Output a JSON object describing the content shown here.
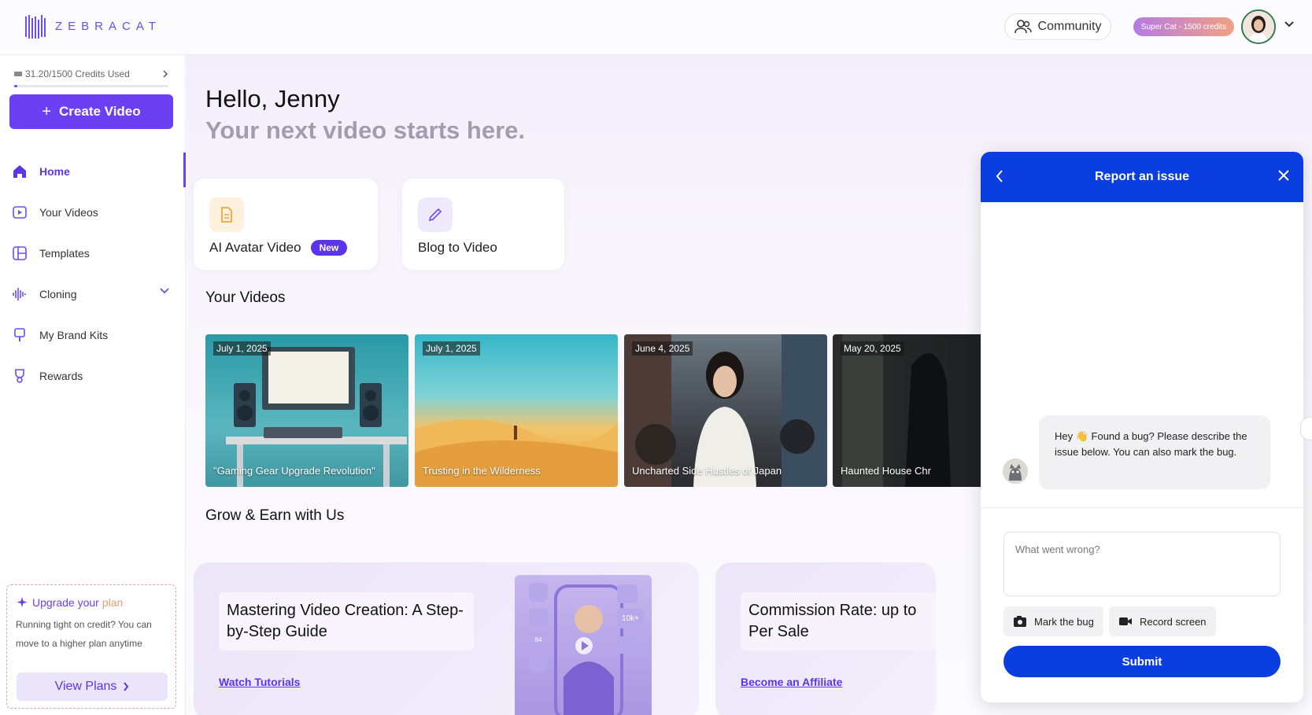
{
  "brand": {
    "name": "ZEBRACAT",
    "accent": "#6b3ff2",
    "panel_blue": "#0b3ee0"
  },
  "header": {
    "community_label": "Community",
    "plan_badge": "Super Cat - 1500 credits"
  },
  "sidebar": {
    "credits_label": "31.20/1500 Credits Used",
    "credits_used_fraction": 0.0208,
    "create_label": "Create Video",
    "items": [
      {
        "label": "Home",
        "icon": "home-icon",
        "active": true
      },
      {
        "label": "Your Videos",
        "icon": "play-square-icon"
      },
      {
        "label": "Templates",
        "icon": "layout-icon"
      },
      {
        "label": "Cloning",
        "icon": "waveform-icon"
      },
      {
        "label": "My Brand Kits",
        "icon": "brand-kit-icon"
      },
      {
        "label": "Rewards",
        "icon": "trophy-icon"
      }
    ],
    "upgrade": {
      "title_part1": "Upgrade your",
      "title_part2": "plan",
      "text": "Running tight on credit? You can move to a higher plan anytime",
      "button": "View Plans"
    }
  },
  "main": {
    "greeting": "Hello, Jenny",
    "subtitle": "Your next video starts here.",
    "quick_actions": [
      {
        "label": "AI Avatar Video",
        "badge": "New",
        "icon": "document-icon"
      },
      {
        "label": "Blog to Video",
        "icon": "pencil-icon"
      }
    ],
    "your_videos_title": "Your Videos",
    "videos": [
      {
        "date": "July 1, 2025",
        "title": "\"Gaming Gear Upgrade Revolution\""
      },
      {
        "date": "July 1, 2025",
        "title": "Trusting in the Wilderness"
      },
      {
        "date": "June 4, 2025",
        "title": "Uncharted Side Hustles of Japan"
      },
      {
        "date": "May 20, 2025",
        "title": "Haunted House Chr"
      }
    ],
    "grow_title": "Grow & Earn with Us",
    "grow_cards": [
      {
        "title": "Mastering Video Creation: A Step-by-Step Guide",
        "link": "Watch Tutorials"
      },
      {
        "title": "Commission Rate: up to Per Sale",
        "link": "Become an Affiliate"
      }
    ],
    "phone_stats": [
      "10k+",
      "84"
    ]
  },
  "report_panel": {
    "title": "Report an issue",
    "message": "Hey 👋 Found a bug? Please describe the issue below. You can also mark the bug.",
    "input_placeholder": "What went wrong?",
    "mark_bug": "Mark the bug",
    "record_screen": "Record screen",
    "submit": "Submit"
  }
}
